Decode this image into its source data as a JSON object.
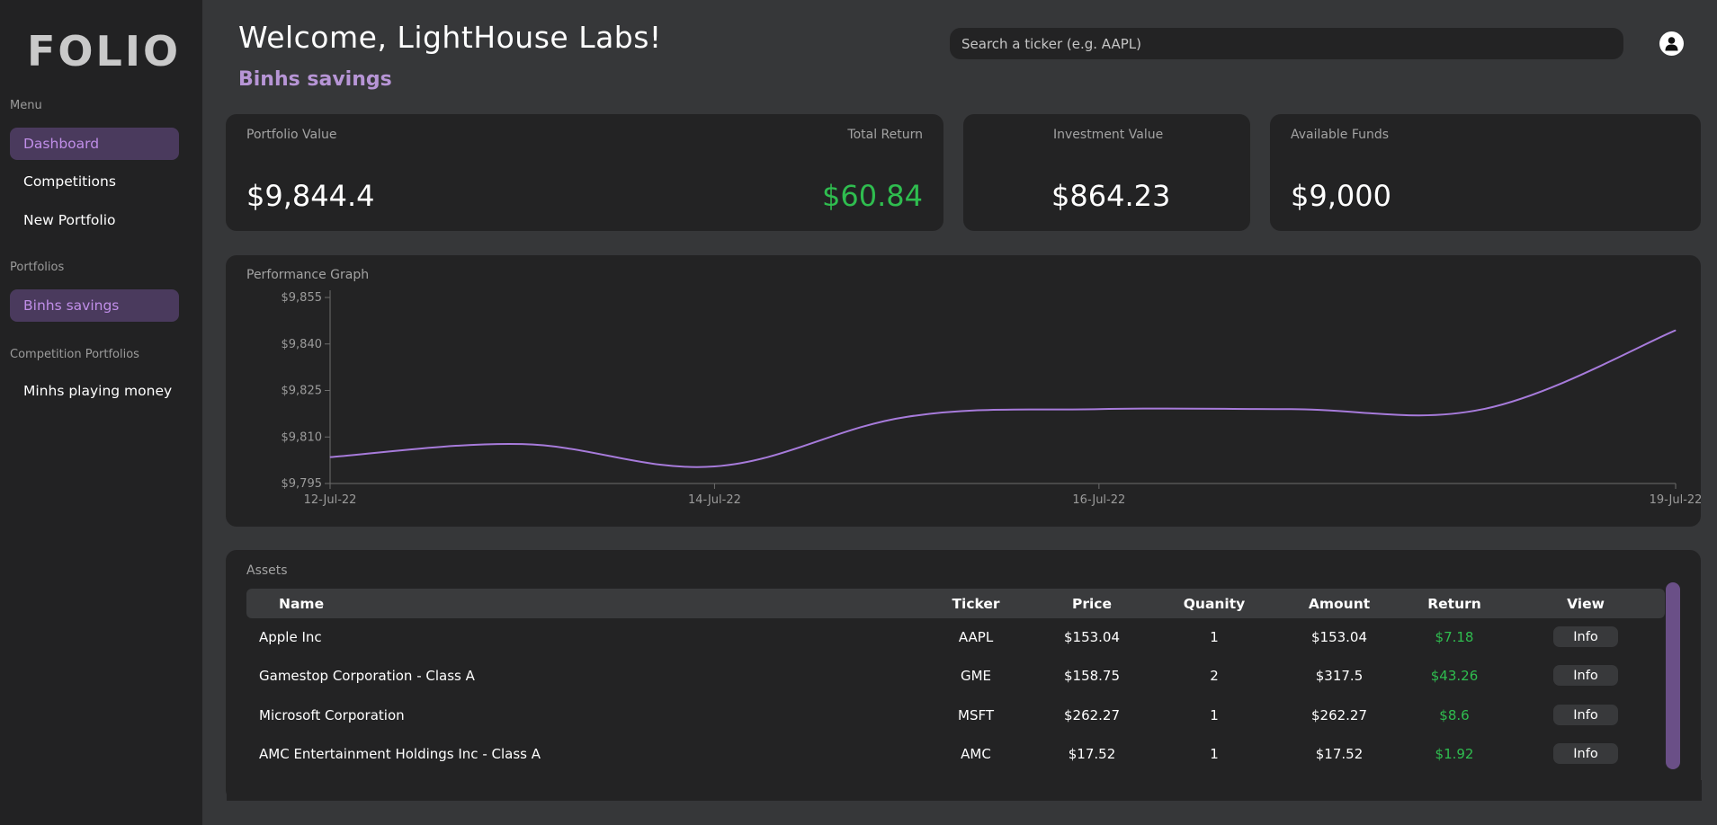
{
  "app": {
    "logo": "FOLIO"
  },
  "sidebar": {
    "menu_label": "Menu",
    "menu_items": [
      {
        "label": "Dashboard",
        "active": true
      },
      {
        "label": "Competitions",
        "active": false
      },
      {
        "label": "New Portfolio",
        "active": false
      }
    ],
    "portfolios_label": "Portfolios",
    "portfolios": [
      {
        "label": "Binhs savings",
        "active": true
      }
    ],
    "competition_label": "Competition Portfolios",
    "competition_portfolios": [
      {
        "label": "Minhs playing money"
      }
    ]
  },
  "header": {
    "welcome": "Welcome, LightHouse Labs!",
    "portfolio_name": "Binhs savings",
    "search_placeholder": "Search a ticker (e.g. AAPL)",
    "avatar_icon": "user-icon"
  },
  "summary": {
    "portfolio_value_label": "Portfolio Value",
    "portfolio_value": "$9,844.4",
    "total_return_label": "Total Return",
    "total_return": "$60.84",
    "investment_value_label": "Investment Value",
    "investment_value": "$864.23",
    "available_funds_label": "Available Funds",
    "available_funds": "$9,000"
  },
  "graph": {
    "title": "Performance Graph"
  },
  "chart_data": {
    "type": "line",
    "x": [
      "12-Jul-22",
      "13-Jul-22",
      "14-Jul-22",
      "15-Jul-22",
      "16-Jul-22",
      "17-Jul-22",
      "18-Jul-22",
      "19-Jul-22"
    ],
    "x_ticks": [
      "12-Jul-22",
      "14-Jul-22",
      "16-Jul-22",
      "19-Jul-22"
    ],
    "values": [
      9803.5,
      9807.7,
      9800.5,
      9816.5,
      9819.0,
      9819.0,
      9819.0,
      9844.4
    ],
    "y_ticks": [
      "$9,795",
      "$9,810",
      "$9,825",
      "$9,840",
      "$9,855"
    ],
    "ylim": [
      9795,
      9855
    ],
    "color": "#a77bdb",
    "grid": false
  },
  "assets": {
    "title": "Assets",
    "columns": [
      "Name",
      "Ticker",
      "Price",
      "Quanity",
      "Amount",
      "Return",
      "View"
    ],
    "rows": [
      {
        "name": "Apple Inc",
        "ticker": "AAPL",
        "price": "$153.04",
        "quantity": "1",
        "amount": "$153.04",
        "return": "$7.18",
        "return_color": "#2fbd4f",
        "view": "Info"
      },
      {
        "name": "Gamestop Corporation - Class A",
        "ticker": "GME",
        "price": "$158.75",
        "quantity": "2",
        "amount": "$317.5",
        "return": "$43.26",
        "return_color": "#2fbd4f",
        "view": "Info"
      },
      {
        "name": "Microsoft Corporation",
        "ticker": "MSFT",
        "price": "$262.27",
        "quantity": "1",
        "amount": "$262.27",
        "return": "$8.6",
        "return_color": "#2fbd4f",
        "view": "Info"
      },
      {
        "name": "AMC Entertainment Holdings Inc - Class A",
        "ticker": "AMC",
        "price": "$17.52",
        "quantity": "1",
        "amount": "$17.52",
        "return": "$1.92",
        "return_color": "#2fbd4f",
        "view": "Info"
      }
    ]
  },
  "colors": {
    "accent": "#b795d6",
    "positive": "#2fbd4f",
    "card": "#232324",
    "background": "#363739"
  }
}
